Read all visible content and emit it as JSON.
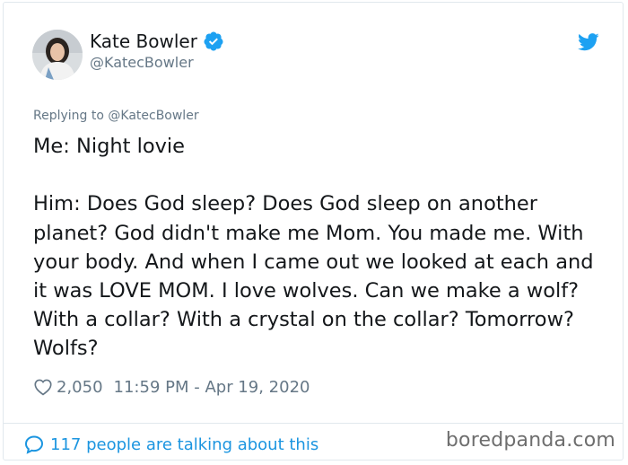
{
  "author": {
    "name": "Kate Bowler",
    "handle": "@KatecBowler",
    "verified": true
  },
  "reply_to": "Replying to @KatecBowler",
  "tweet": {
    "text": "Me: Night lovie\n\nHim: Does God sleep? Does God sleep on another planet? God didn't make me Mom. You made me. With your body. And when I came out we looked at each and it was LOVE MOM. I love wolves. Can we make a wolf? With a collar? With a crystal on the collar? Tomorrow? Wolfs?",
    "likes": "2,050",
    "timestamp": "11:59 PM - Apr 19, 2020"
  },
  "footer": {
    "talking": "117 people are talking about this"
  },
  "watermark": "boredpanda.com",
  "icons": {
    "platform": "twitter-bird-icon",
    "verified": "verified-badge-icon",
    "like": "heart-icon",
    "reply": "speech-bubble-icon"
  },
  "colors": {
    "accent": "#1da1f2",
    "link": "#1b95e0",
    "muted": "#657786",
    "text": "#14171a"
  }
}
